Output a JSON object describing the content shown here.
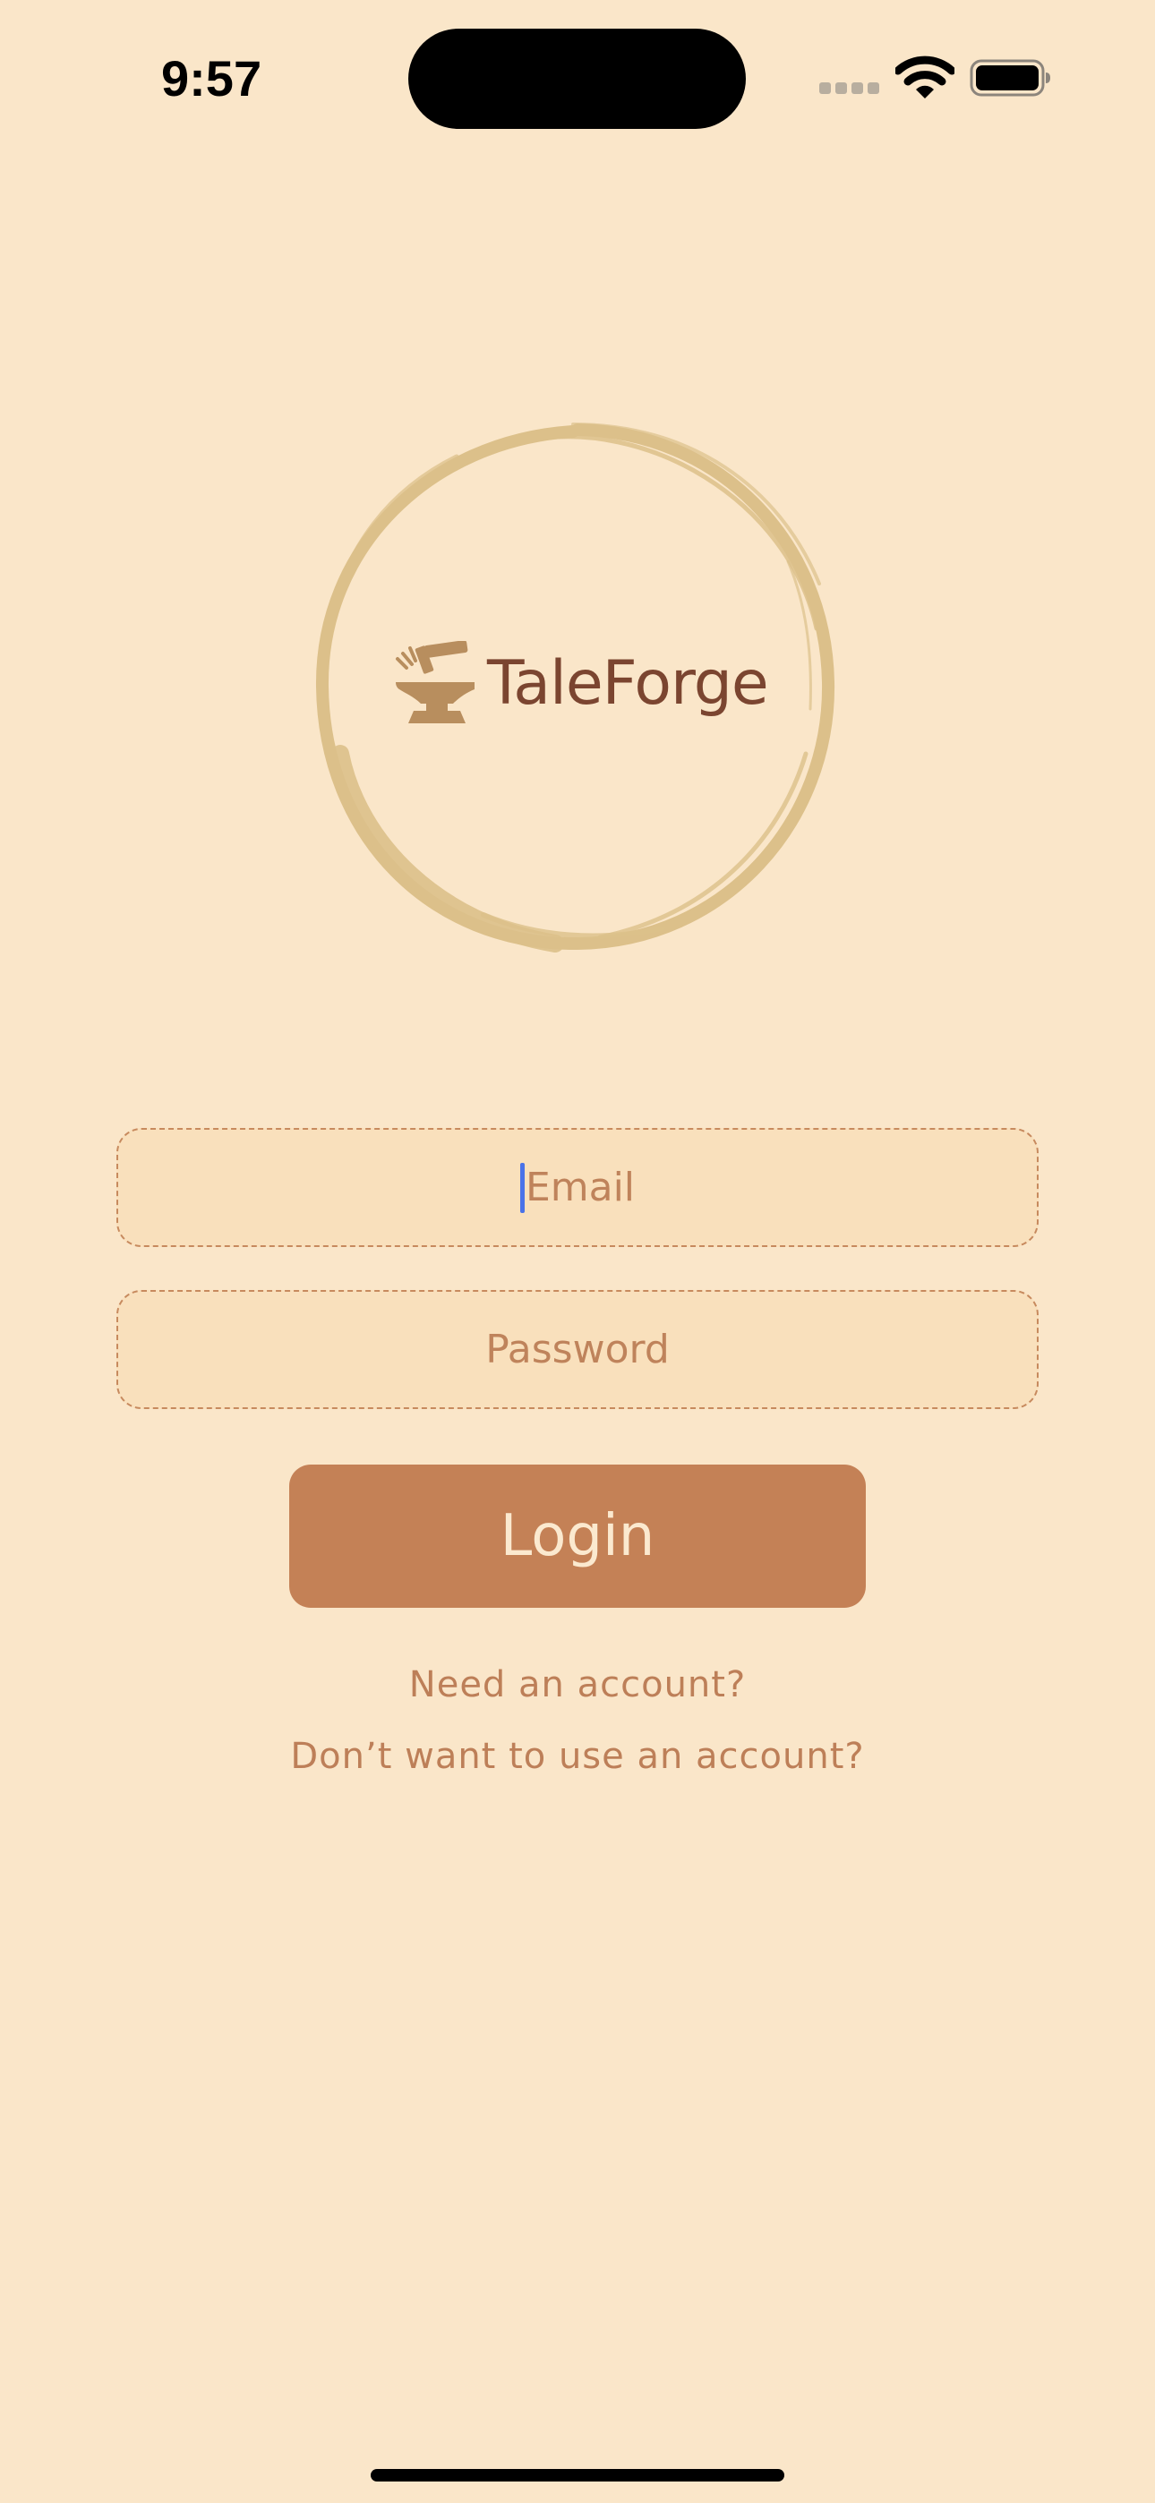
{
  "status_bar": {
    "time": "9:57",
    "icons": [
      "cellular-signal-icon",
      "wifi-icon",
      "battery-icon"
    ]
  },
  "logo": {
    "brand_name": "TaleForge",
    "icon": "anvil-hammer-icon"
  },
  "form": {
    "email": {
      "placeholder": "Email",
      "value": ""
    },
    "password": {
      "placeholder": "Password",
      "value": ""
    },
    "login_label": "Login"
  },
  "links": {
    "signup_label": "Need an account?",
    "guest_label": "Don’t want to use an account?"
  },
  "colors": {
    "background": "#FAE6C9",
    "accent": "#C48156",
    "brand_text": "#7B4530",
    "ring": "#DCC08A",
    "caret": "#4A72E8"
  }
}
